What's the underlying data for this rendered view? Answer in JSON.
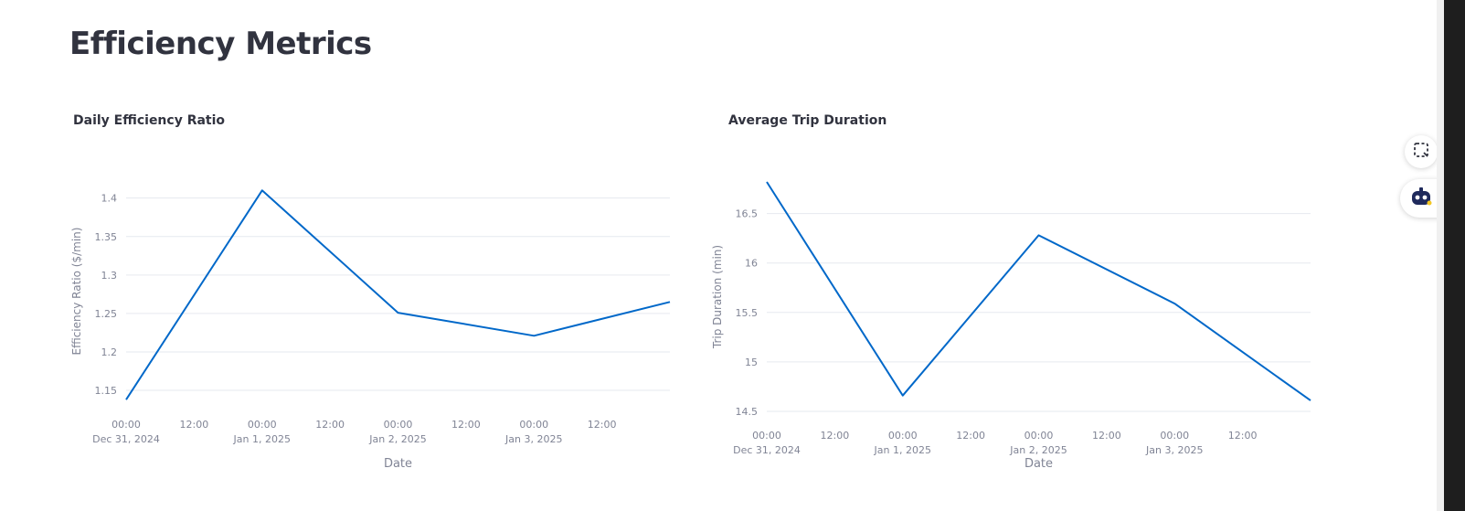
{
  "page": {
    "title": "Efficiency Metrics"
  },
  "charts": [
    {
      "panel_title": "Daily Efficiency Ratio"
    },
    {
      "panel_title": "Average Trip Duration"
    }
  ],
  "toolbar": {
    "capture_icon": "screenshot-select-icon",
    "assistant_icon": "robot-assistant-icon"
  },
  "colors": {
    "line": "#0068c9",
    "grid": "#e6e9ef",
    "text": "#31333f",
    "axis_text": "#808495"
  },
  "chart_data": [
    {
      "type": "line",
      "title": "Daily Efficiency Ratio",
      "xlabel": "Date",
      "ylabel": "Efficiency Ratio ($/min)",
      "x_ticks": [
        {
          "t": "2024-12-31T00:00",
          "line1": "00:00",
          "line2": "Dec 31, 2024"
        },
        {
          "t": "2024-12-31T12:00",
          "line1": "12:00",
          "line2": ""
        },
        {
          "t": "2025-01-01T00:00",
          "line1": "00:00",
          "line2": "Jan 1, 2025"
        },
        {
          "t": "2025-01-01T12:00",
          "line1": "12:00",
          "line2": ""
        },
        {
          "t": "2025-01-02T00:00",
          "line1": "00:00",
          "line2": "Jan 2, 2025"
        },
        {
          "t": "2025-01-02T12:00",
          "line1": "12:00",
          "line2": ""
        },
        {
          "t": "2025-01-03T00:00",
          "line1": "00:00",
          "line2": "Jan 3, 2025"
        },
        {
          "t": "2025-01-03T12:00",
          "line1": "12:00",
          "line2": ""
        }
      ],
      "xlim": [
        "2024-12-31T00:00",
        "2025-01-04T00:00"
      ],
      "y_ticks": [
        "1.15",
        "1.2",
        "1.25",
        "1.3",
        "1.35",
        "1.4"
      ],
      "ylim": [
        1.137,
        1.421
      ],
      "grid": true,
      "series": [
        {
          "x": [
            "2024-12-31T00:00",
            "2025-01-01T00:00",
            "2025-01-02T00:00",
            "2025-01-03T00:00",
            "2025-01-04T00:00"
          ],
          "values": [
            1.138,
            1.41,
            1.251,
            1.221,
            1.265
          ]
        }
      ]
    },
    {
      "type": "line",
      "title": "Average Trip Duration",
      "xlabel": "Date",
      "ylabel": "Trip Duration (min)",
      "x_ticks": [
        {
          "t": "2024-12-31T00:00",
          "line1": "00:00",
          "line2": "Dec 31, 2024"
        },
        {
          "t": "2024-12-31T12:00",
          "line1": "12:00",
          "line2": ""
        },
        {
          "t": "2025-01-01T00:00",
          "line1": "00:00",
          "line2": "Jan 1, 2025"
        },
        {
          "t": "2025-01-01T12:00",
          "line1": "12:00",
          "line2": ""
        },
        {
          "t": "2025-01-02T00:00",
          "line1": "00:00",
          "line2": "Jan 2, 2025"
        },
        {
          "t": "2025-01-02T12:00",
          "line1": "12:00",
          "line2": ""
        },
        {
          "t": "2025-01-03T00:00",
          "line1": "00:00",
          "line2": "Jan 3, 2025"
        },
        {
          "t": "2025-01-03T12:00",
          "line1": "12:00",
          "line2": ""
        }
      ],
      "xlim": [
        "2024-12-31T00:00",
        "2025-01-04T00:00"
      ],
      "y_ticks": [
        "14.5",
        "15",
        "15.5",
        "16",
        "16.5"
      ],
      "ylim": [
        14.5,
        16.82
      ],
      "grid": true,
      "series": [
        {
          "x": [
            "2024-12-31T00:00",
            "2025-01-01T00:00",
            "2025-01-02T00:00",
            "2025-01-03T00:00",
            "2025-01-04T00:00"
          ],
          "values": [
            16.82,
            14.66,
            16.28,
            15.59,
            14.61
          ]
        }
      ]
    }
  ]
}
